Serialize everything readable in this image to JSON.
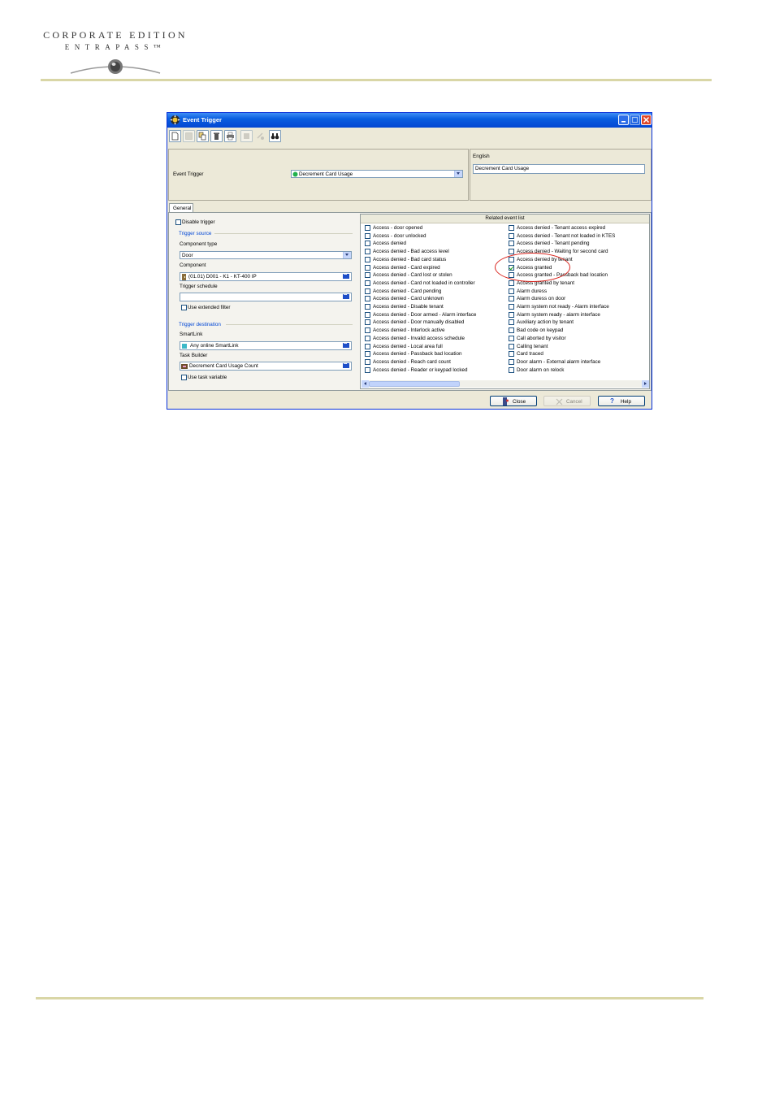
{
  "logo": {
    "line1": "CORPORATE EDITION",
    "line2": "ENTRAPASS™"
  },
  "window": {
    "title": "Event Trigger",
    "header": {
      "event_trigger_label": "Event Trigger",
      "event_trigger_value": "Decrement Card Usage",
      "language_label": "English",
      "language_value": "Decrement Card Usage"
    },
    "tab": "General",
    "left": {
      "disable_trigger": "Disable trigger",
      "trigger_source_title": "Trigger source",
      "component_type_label": "Component type",
      "component_type_value": "Door",
      "component_label": "Component",
      "component_value": "(01.01) D001 - K1 - KT-400 IP",
      "trigger_schedule_label": "Trigger schedule",
      "trigger_schedule_value": "",
      "use_extended_filter": "Use extended filter",
      "trigger_destination_title": "Trigger destination",
      "smartlink_label": "SmartLink",
      "smartlink_value": "Any online SmartLink",
      "task_builder_label": "Task Builder",
      "task_builder_value": "Decrement Card Usage Count",
      "use_task_variable": "Use task variable"
    },
    "events": {
      "header": "Related event list",
      "col1": [
        "Access - door opened",
        "Access - door unlocked",
        "Access denied",
        "Access denied - Bad access level",
        "Access denied - Bad card status",
        "Access denied - Card expired",
        "Access denied - Card lost or stolen",
        "Access denied - Card not loaded in controller",
        "Access denied - Card pending",
        "Access denied - Card unknown",
        "Access denied - Disable tenant",
        "Access denied - Door armed - Alarm interface",
        "Access denied - Door manually disabled",
        "Access denied - Interlock active",
        "Access denied - Invalid access schedule",
        "Access denied - Local area full",
        "Access denied - Passback bad location",
        "Access denied - Reach card count",
        "Access denied - Reader or keypad locked"
      ],
      "col2": [
        "Access denied - Tenant access expired",
        "Access denied - Tenant not loaded in KTES",
        "Access denied - Tenant pending",
        "Access denied - Waiting for second card",
        "Access denied by tenant",
        "Access granted",
        "Access granted - Passback bad location",
        "Access granted by tenant",
        "Alarm duress",
        "Alarm duress on door",
        "Alarm system not ready - Alarm interface",
        "Alarm system ready - alarm interface",
        "Auxiliary action by tenant",
        "Bad code on keypad",
        "Call aborted by visitor",
        "Calling tenant",
        "Card traced",
        "Door alarm - External alarm interface",
        "Door alarm on relock"
      ],
      "checked": "Access granted"
    },
    "buttons": {
      "close": "Close",
      "cancel": "Cancel",
      "help": "Help"
    }
  },
  "colors": {
    "rule": "#d9d6a6",
    "title_bar": "#0a5ee0",
    "highlight_circle": "#d9231c"
  }
}
